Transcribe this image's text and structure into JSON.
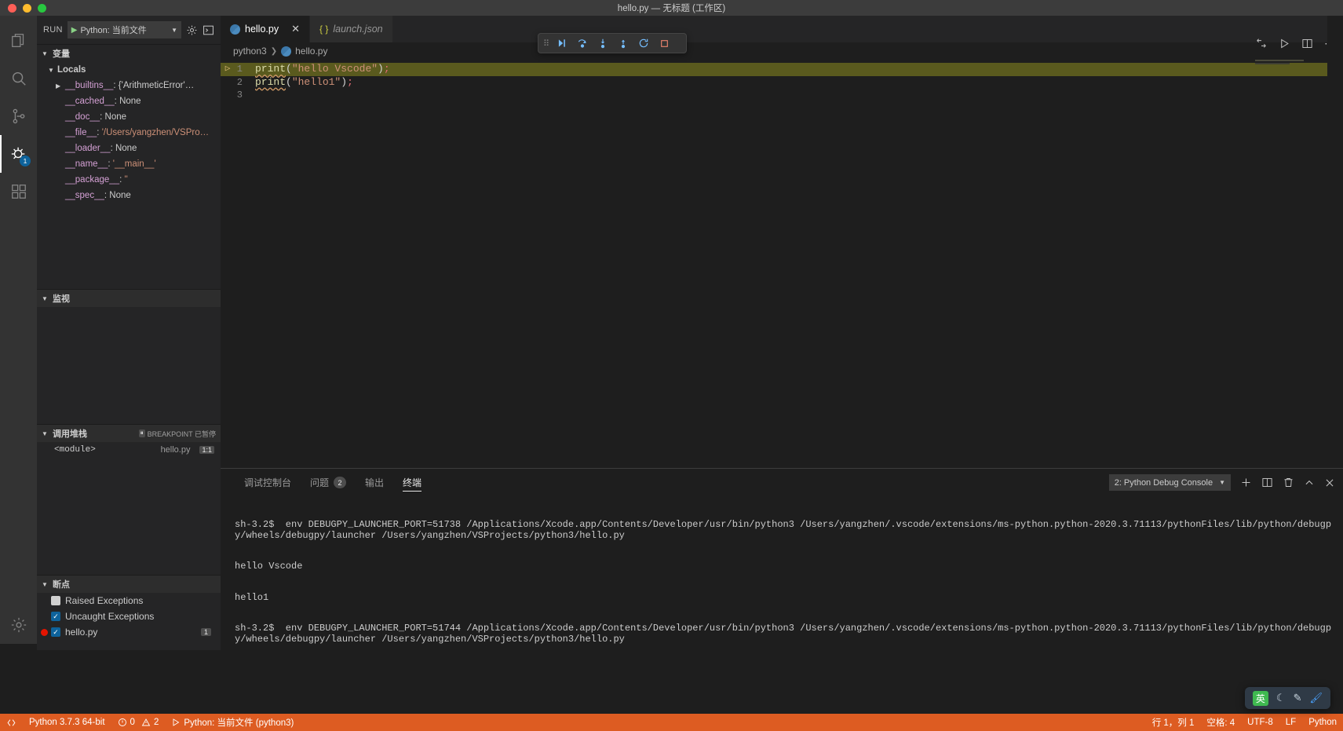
{
  "window": {
    "title": "hello.py — 无标题 (工作区)"
  },
  "activitybar": {
    "items": [
      {
        "name": "explorer",
        "icon": "files-icon"
      },
      {
        "name": "search",
        "icon": "search-icon"
      },
      {
        "name": "source-control",
        "icon": "source-control-icon"
      },
      {
        "name": "run-and-debug",
        "icon": "debug-icon",
        "badge": "1"
      },
      {
        "name": "extensions",
        "icon": "extensions-icon"
      }
    ],
    "settings_icon": "gear-icon"
  },
  "sidebar": {
    "run_label": "RUN",
    "launch_config": "Python: 当前文件",
    "gear_icon": "gear-icon",
    "console_icon": "open-console-icon",
    "sections": {
      "variables": {
        "title": "变量",
        "scope": "Locals",
        "rows": [
          {
            "name": "__builtins__",
            "value": "{'ArithmeticError'…",
            "expandable": true,
            "is_string": false
          },
          {
            "name": "__cached__",
            "value": "None",
            "expandable": false,
            "is_string": false
          },
          {
            "name": "__doc__",
            "value": "None",
            "expandable": false,
            "is_string": false
          },
          {
            "name": "__file__",
            "value": "'/Users/yangzhen/VSPro…",
            "expandable": false,
            "is_string": true
          },
          {
            "name": "__loader__",
            "value": "None",
            "expandable": false,
            "is_string": false
          },
          {
            "name": "__name__",
            "value": "'__main__'",
            "expandable": false,
            "is_string": true
          },
          {
            "name": "__package__",
            "value": "''",
            "expandable": false,
            "is_string": true
          },
          {
            "name": "__spec__",
            "value": "None",
            "expandable": false,
            "is_string": false
          }
        ]
      },
      "watch": {
        "title": "监视",
        "rows": []
      },
      "callstack": {
        "title": "调用堆栈",
        "status": "BREAKPOINT 已暂停",
        "status_icon": "pause-icon",
        "frames": [
          {
            "fn": "<module>",
            "file": "hello.py",
            "line": "1:1"
          }
        ]
      },
      "breakpoints": {
        "title": "断点",
        "items": [
          {
            "label": "Raised Exceptions",
            "checked": false,
            "dot": false,
            "count": ""
          },
          {
            "label": "Uncaught Exceptions",
            "checked": true,
            "dot": false,
            "count": ""
          },
          {
            "label": "hello.py",
            "checked": true,
            "dot": true,
            "count": "1"
          }
        ]
      }
    }
  },
  "editor": {
    "tabs": [
      {
        "label": "hello.py",
        "icon": "python-icon",
        "active": true,
        "italic": false,
        "closable": true
      },
      {
        "label": "launch.json",
        "icon": "json-icon",
        "active": false,
        "italic": true,
        "closable": false
      }
    ],
    "close_icon": "close-icon",
    "breadcrumb": [
      "python3",
      "hello.py"
    ],
    "lines": [
      {
        "num": "1",
        "fn": "print",
        "open": "(",
        "str": "\"hello Vscode\"",
        "close": ")",
        "semi": ";",
        "current": true
      },
      {
        "num": "2",
        "fn": "print",
        "open": "(",
        "str": "\"hello1\"",
        "close": ")",
        "semi": ";",
        "current": false
      },
      {
        "num": "3",
        "fn": "",
        "open": "",
        "str": "",
        "close": "",
        "semi": "",
        "current": false
      }
    ],
    "debug_toolbar": {
      "grip_icon": "drag-grip-icon",
      "buttons": [
        {
          "name": "continue-button",
          "icon": "continue-icon",
          "glyph": "▶|"
        },
        {
          "name": "step-over-button",
          "icon": "step-over-icon",
          "glyph": "↷"
        },
        {
          "name": "step-into-button",
          "icon": "step-into-icon",
          "glyph": "↓"
        },
        {
          "name": "step-out-button",
          "icon": "step-out-icon",
          "glyph": "↑"
        },
        {
          "name": "restart-button",
          "icon": "restart-icon",
          "glyph": "↺"
        },
        {
          "name": "stop-button",
          "icon": "stop-icon",
          "glyph": "■"
        }
      ]
    },
    "actions": [
      {
        "name": "split-terminal-action",
        "icon": "run-python-file-icon"
      },
      {
        "name": "run-file-action",
        "icon": "play-icon"
      },
      {
        "name": "split-editor-action",
        "icon": "split-editor-icon"
      },
      {
        "name": "more-actions",
        "icon": "ellipsis-icon"
      }
    ]
  },
  "panel": {
    "tabs": [
      {
        "label": "调试控制台",
        "badge": "",
        "active": false
      },
      {
        "label": "问题",
        "badge": "2",
        "active": false
      },
      {
        "label": "输出",
        "badge": "",
        "active": false
      },
      {
        "label": "终端",
        "badge": "",
        "active": true
      }
    ],
    "terminal_select": "2: Python Debug Console",
    "actions": [
      {
        "name": "new-terminal-button",
        "icon": "plus-icon"
      },
      {
        "name": "split-terminal-button",
        "icon": "split-icon"
      },
      {
        "name": "kill-terminal-button",
        "icon": "trash-icon"
      },
      {
        "name": "maximize-panel-button",
        "icon": "chevron-up-icon"
      },
      {
        "name": "close-panel-button",
        "icon": "close-icon"
      }
    ],
    "terminal_lines": [
      "sh-3.2$  env DEBUGPY_LAUNCHER_PORT=51738 /Applications/Xcode.app/Contents/Developer/usr/bin/python3 /Users/yangzhen/.vscode/extensions/ms-python.python-2020.3.71113/pythonFiles/lib/python/debugpy/wheels/debugpy/launcher /Users/yangzhen/VSProjects/python3/hello.py",
      "hello Vscode",
      "hello1",
      "sh-3.2$  env DEBUGPY_LAUNCHER_PORT=51744 /Applications/Xcode.app/Contents/Developer/usr/bin/python3 /Users/yangzhen/.vscode/extensions/ms-python.python-2020.3.71113/pythonFiles/lib/python/debugpy/wheels/debugpy/launcher /Users/yangzhen/VSProjects/python3/hello.py"
    ]
  },
  "statusbar": {
    "left": [
      {
        "name": "remote-indicator",
        "label": "",
        "icon": "remote-icon"
      },
      {
        "name": "python-version",
        "label": "Python 3.7.3 64-bit",
        "icon": ""
      },
      {
        "name": "problems-status",
        "label": "0",
        "label2": "2",
        "icon": "error-warning-icon"
      },
      {
        "name": "debug-config-status",
        "label": "Python: 当前文件 (python3)",
        "icon": "play-icon"
      }
    ],
    "right": [
      {
        "name": "cursor-position",
        "label": "行 1，列 1"
      },
      {
        "name": "indent-setting",
        "label": "空格: 4"
      },
      {
        "name": "encoding-setting",
        "label": "UTF-8"
      },
      {
        "name": "eol-setting",
        "label": "LF"
      },
      {
        "name": "language-mode",
        "label": "Python"
      }
    ]
  },
  "ime": {
    "mode": "英",
    "icons": [
      "moon-icon",
      "wand-icon",
      "brush-icon"
    ]
  }
}
